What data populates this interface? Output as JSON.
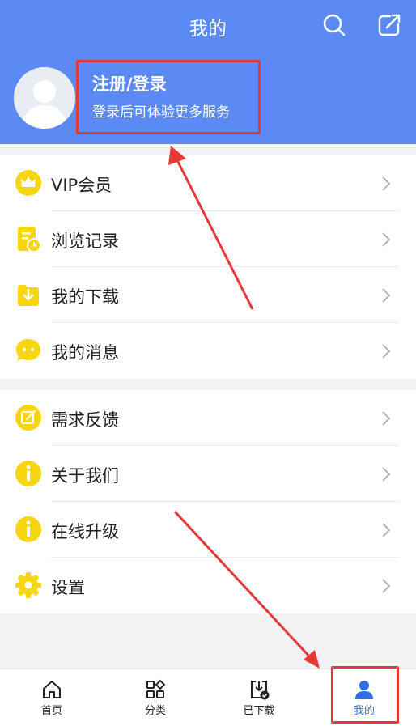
{
  "header": {
    "title": "我的",
    "login_title": "注册/登录",
    "login_subtitle": "登录后可体验更多服务",
    "search_icon": "search-icon",
    "share_icon": "share-icon"
  },
  "menu_group_1": [
    {
      "label": "VIP会员",
      "icon": "crown-icon"
    },
    {
      "label": "浏览记录",
      "icon": "history-icon"
    },
    {
      "label": "我的下载",
      "icon": "download-icon"
    },
    {
      "label": "我的消息",
      "icon": "message-icon"
    }
  ],
  "menu_group_2": [
    {
      "label": "需求反馈",
      "icon": "feedback-icon"
    },
    {
      "label": "关于我们",
      "icon": "info-icon"
    },
    {
      "label": "在线升级",
      "icon": "upgrade-icon"
    },
    {
      "label": "设置",
      "icon": "gear-icon"
    }
  ],
  "tabs": [
    {
      "label": "首页",
      "icon": "home-icon"
    },
    {
      "label": "分类",
      "icon": "category-icon"
    },
    {
      "label": "已下载",
      "icon": "downloaded-icon"
    },
    {
      "label": "我的",
      "icon": "user-icon",
      "active": true
    }
  ],
  "colors": {
    "header_bg": "#5b8af5",
    "icon_yellow": "#f5d60f",
    "annotation_red": "#e53935",
    "active_tab": "#2f6fe0"
  }
}
